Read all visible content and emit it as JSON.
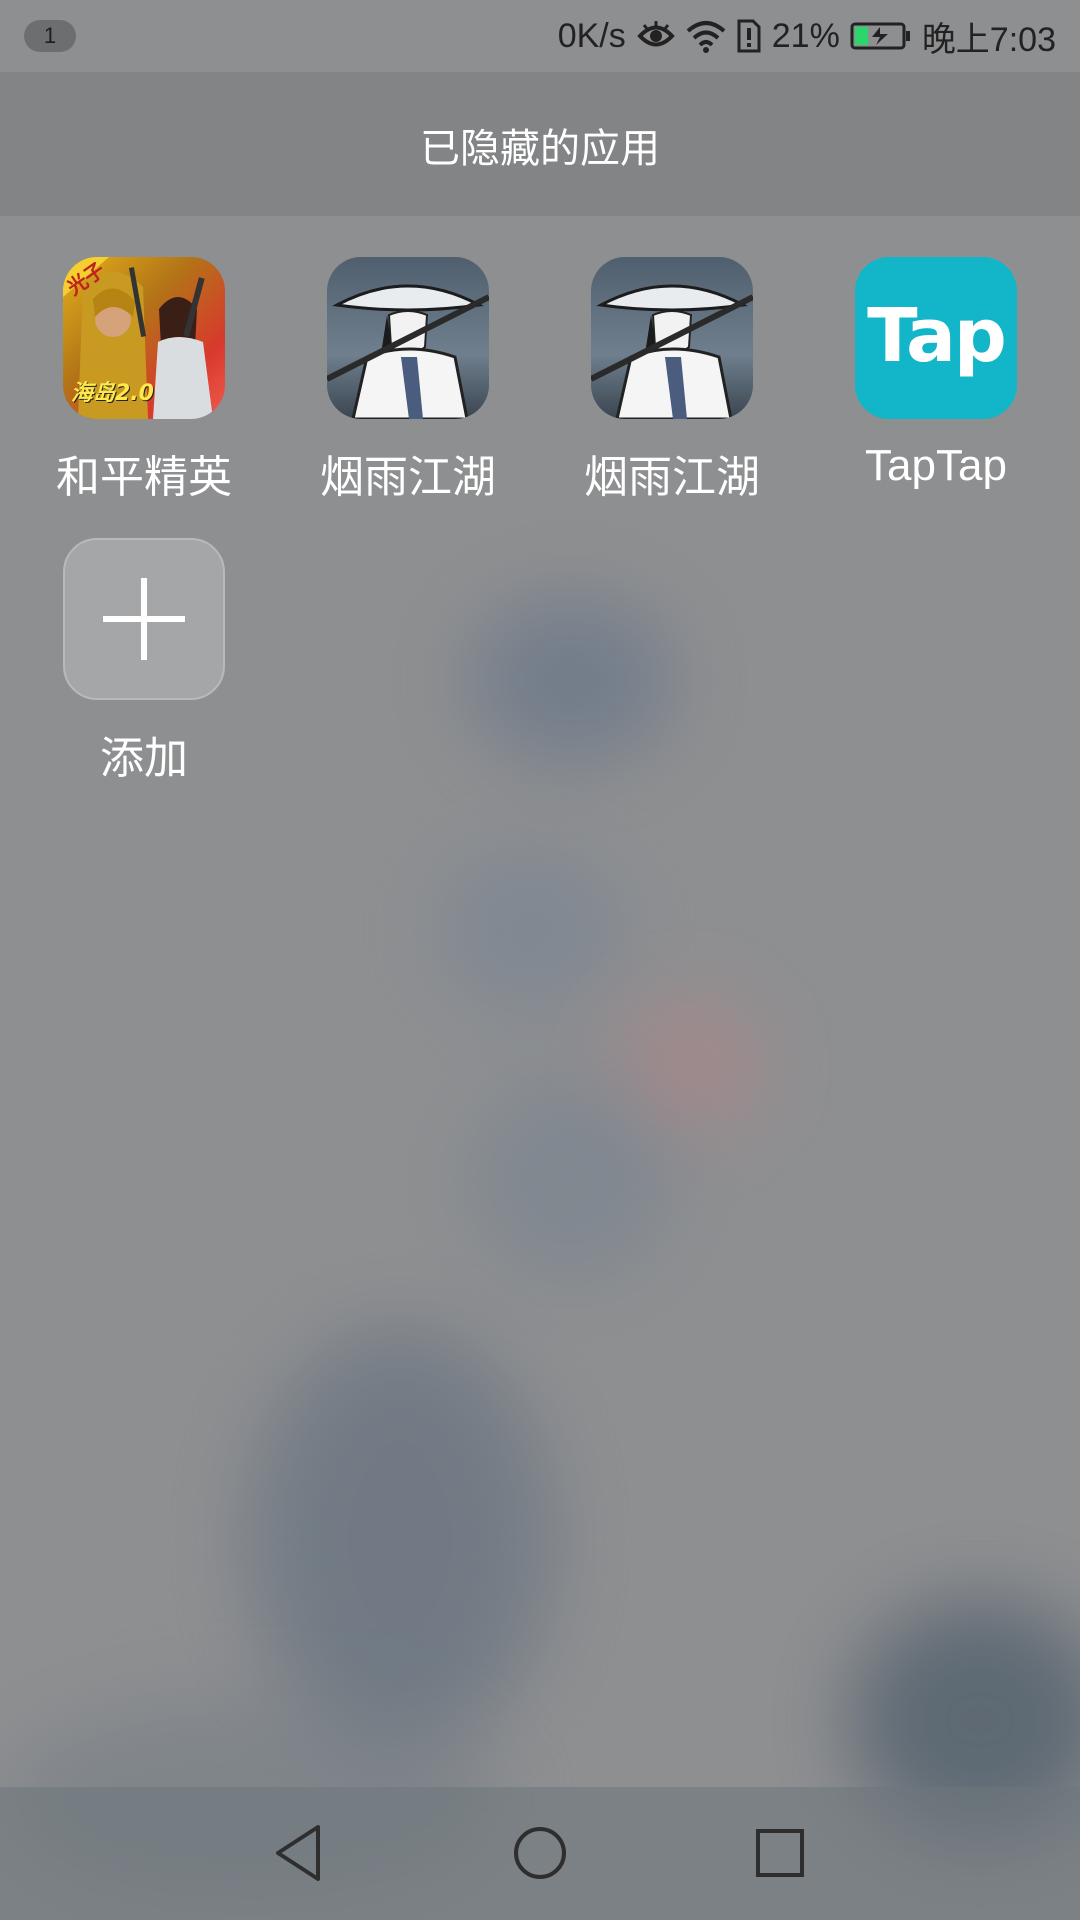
{
  "status_bar": {
    "notification_count": "1",
    "net_speed": "0K/s",
    "battery_percent": "21%",
    "time": "晚上7:03",
    "icons": [
      "eye-icon",
      "wifi-icon",
      "sim-alert-icon",
      "battery-charging-icon"
    ],
    "battery_fill_color": "#2bd66b"
  },
  "header": {
    "title": "已隐藏的应用"
  },
  "apps": [
    {
      "label": "和平精英",
      "icon": "peace-elite-game-icon",
      "badge_text": "光子",
      "corner_text": "海岛2.0"
    },
    {
      "label": "烟雨江湖",
      "icon": "yanyu-jianghu-game-icon"
    },
    {
      "label": "烟雨江湖",
      "icon": "yanyu-jianghu-game-icon"
    },
    {
      "label": "TapTap",
      "icon": "taptap-icon",
      "icon_text": "Tap"
    }
  ],
  "add_tile": {
    "label": "添加",
    "icon": "plus-icon"
  },
  "nav_bar": {
    "buttons": [
      "back-icon",
      "home-icon",
      "recents-icon"
    ]
  },
  "colors": {
    "tap_brand": "#12b6c8"
  }
}
